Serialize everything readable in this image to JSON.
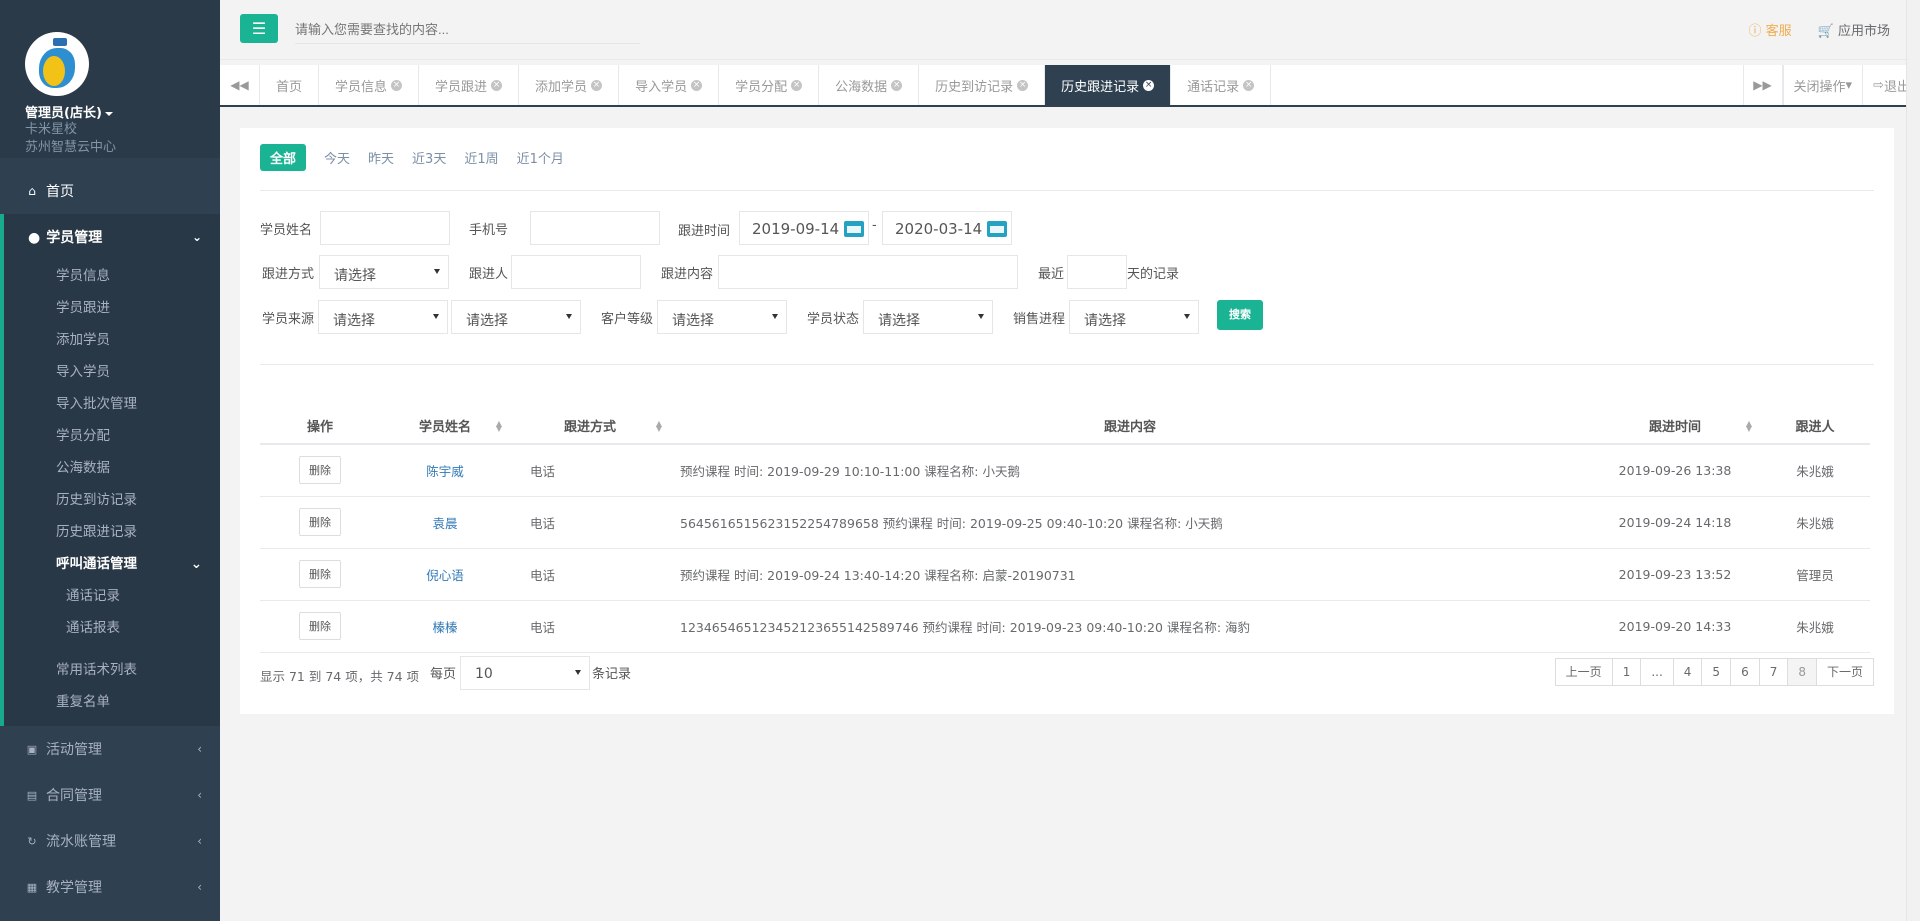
{
  "profile": {
    "name": "管理员(店长)",
    "school": "卡米星校",
    "center": "苏州智慧云中心"
  },
  "nav": {
    "home": "首页",
    "student_mgmt": "学员管理",
    "student_sub": [
      "学员信息",
      "学员跟进",
      "添加学员",
      "导入学员",
      "导入批次管理",
      "学员分配",
      "公海数据",
      "历史到访记录",
      "历史跟进记录"
    ],
    "call_mgmt": "呼叫通话管理",
    "call_sub": [
      "通话记录",
      "通话报表"
    ],
    "extra_sub": [
      "常用话术列表",
      "重复名单"
    ],
    "closed": [
      {
        "label": "活动管理",
        "icon": "book-icon"
      },
      {
        "label": "合同管理",
        "icon": "cart-icon"
      },
      {
        "label": "流水账管理",
        "icon": "refresh-icon"
      },
      {
        "label": "教学管理",
        "icon": "calendar-icon"
      }
    ]
  },
  "topbar": {
    "search_placeholder": "请输入您需要查找的内容...",
    "kefu": "客服",
    "market": "应用市场"
  },
  "tabs": [
    {
      "label": "首页",
      "closable": false,
      "active": false
    },
    {
      "label": "学员信息",
      "closable": true,
      "active": false
    },
    {
      "label": "学员跟进",
      "closable": true,
      "active": false
    },
    {
      "label": "添加学员",
      "closable": true,
      "active": false
    },
    {
      "label": "导入学员",
      "closable": true,
      "active": false
    },
    {
      "label": "学员分配",
      "closable": true,
      "active": false
    },
    {
      "label": "公海数据",
      "closable": true,
      "active": false
    },
    {
      "label": "历史到访记录",
      "closable": true,
      "active": false
    },
    {
      "label": "历史跟进记录",
      "closable": true,
      "active": true
    },
    {
      "label": "通话记录",
      "closable": true,
      "active": false
    }
  ],
  "tab_actions": {
    "close_ops": "关闭操作",
    "logout": "退出"
  },
  "quick": [
    "全部",
    "今天",
    "昨天",
    "近3天",
    "近1周",
    "近1个月"
  ],
  "filters": {
    "student_name": "学员姓名",
    "phone": "手机号",
    "follow_time": "跟进时间",
    "date_from": "2019-09-14",
    "date_to": "2020-03-14",
    "date_sep": "-",
    "follow_method": "跟进方式",
    "follower": "跟进人",
    "follow_content": "跟进内容",
    "recent": "最近",
    "recent_suffix": "天的记录",
    "source": "学员来源",
    "customer_level": "客户等级",
    "student_status": "学员状态",
    "sales_progress": "销售进程",
    "select_placeholder": "请选择",
    "search_btn": "搜索"
  },
  "table": {
    "headers": [
      "操作",
      "学员姓名",
      "跟进方式",
      "跟进内容",
      "跟进时间",
      "跟进人"
    ],
    "delete_label": "删除",
    "rows": [
      {
        "name": "陈宇威",
        "method": "电话",
        "content": "预约课程 时间: 2019-09-29 10:10-11:00 课程名称: 小天鹅",
        "time": "2019-09-26 13:38",
        "follower": "朱兆娥"
      },
      {
        "name": "袁晨",
        "method": "电话",
        "content": "56456165156231522547896​58 预约课程 时间: 2019-09-25 09:40-10:20 课程名称: 小天鹅",
        "time": "2019-09-24 14:18",
        "follower": "朱兆娥"
      },
      {
        "name": "倪心语",
        "method": "电话",
        "content": "预约课程 时间: 2019-09-24 13:40-14:20 课程名称: 启蒙-20190731",
        "time": "2019-09-23 13:52",
        "follower": "管理员"
      },
      {
        "name": "榛榛",
        "method": "电话",
        "content": "123465465123452123655142589746 预约课程 时间: 2019-09-23 09:40-10:20 课程名称: 海豹",
        "time": "2019-09-20 14:33",
        "follower": "朱兆娥"
      }
    ]
  },
  "footer": {
    "info": "显示 71 到 74 项，共 74 项",
    "per_page": "每页",
    "per_page_value": "10",
    "suffix": "条记录"
  },
  "pager": [
    "上一页",
    "1",
    "...",
    "4",
    "5",
    "6",
    "7",
    "8",
    "下一页"
  ],
  "current_page": "8"
}
